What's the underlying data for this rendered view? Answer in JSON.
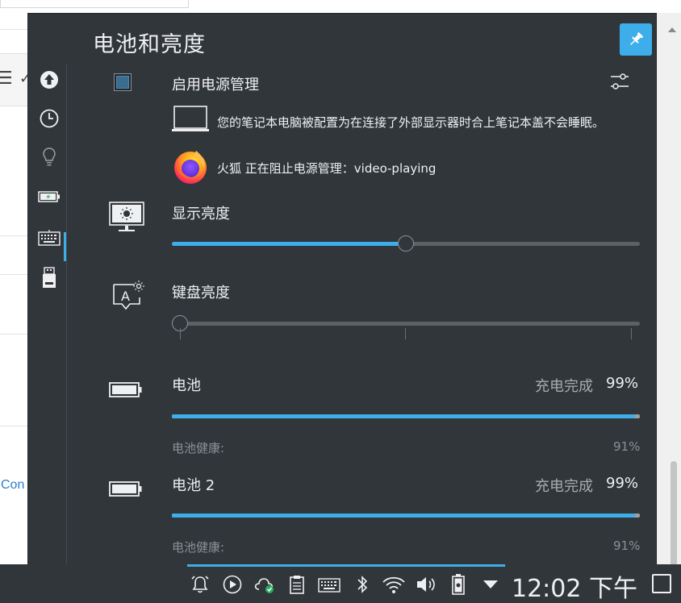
{
  "background": {
    "link_fragment": "Con"
  },
  "popup": {
    "title": "电池和亮度"
  },
  "power_management": {
    "label": "启用电源管理",
    "enabled": true,
    "laptop_notice": "您的笔记本电脑被配置为在连接了外部显示器时合上笔记本盖不会睡眠。",
    "inhibitor": "火狐 正在阻止电源管理：video-playing"
  },
  "display_brightness": {
    "label": "显示亮度",
    "level": 0.5
  },
  "keyboard_brightness": {
    "label": "键盘亮度",
    "level": 0.0
  },
  "batteries": [
    {
      "name": "电池",
      "status": "充电完成",
      "percent": "99%",
      "percent_value": 99,
      "health_label": "电池健康:",
      "health": "91%"
    },
    {
      "name": "电池 2",
      "status": "充电完成",
      "percent": "99%",
      "percent_value": 99,
      "health_label": "电池健康:",
      "health": "91%"
    }
  ],
  "sidebar_icons": [
    "updates-icon",
    "clock-icon",
    "lightbulb-icon",
    "battery-icon",
    "keyboard-icon",
    "usb-drive-icon"
  ],
  "tray_icons": [
    "notifications-icon",
    "media-player-icon",
    "cloud-sync-icon",
    "clipboard-icon",
    "keyboard-layout-icon",
    "bluetooth-icon",
    "wifi-icon",
    "volume-icon",
    "battery-tray-icon",
    "expand-tray-icon"
  ],
  "taskbar": {
    "clock": "12:02 下午"
  },
  "colors": {
    "popup_bg": "#31363b",
    "accent": "#3daee9",
    "text": "#eff0f1",
    "dim_text": "#8b9096"
  }
}
